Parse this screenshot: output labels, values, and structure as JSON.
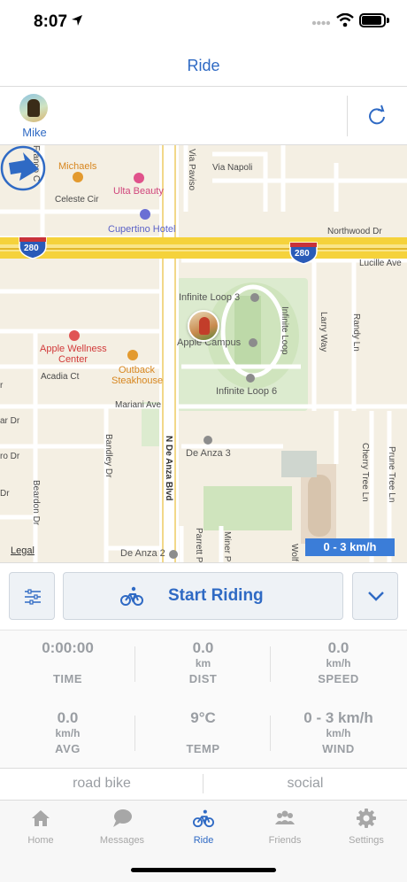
{
  "status_bar": {
    "time": "8:07"
  },
  "nav": {
    "title": "Ride"
  },
  "user": {
    "name": "Mike"
  },
  "map": {
    "pois": {
      "michaels": "Michaels",
      "ulta": "Ulta Beauty",
      "cupertino_hotel": "Cupertino Hotel",
      "infinite_loop_3": "Infinite Loop 3",
      "apple_campus": "Apple Campus",
      "infinite_loop_6": "Infinite Loop 6",
      "apple_wellness_1": "Apple Wellness",
      "apple_wellness_2": "Center",
      "outback_1": "Outback",
      "outback_2": "Steakhouse",
      "de_anza_3": "De Anza 3",
      "de_anza_2": "De Anza 2"
    },
    "streets": {
      "franco": "Franco C",
      "via_paviso": "Via Paviso",
      "via_napoli": "Via Napoli",
      "celeste": "Celeste Cir",
      "northwood": "Northwood Dr",
      "lucille": "Lucille Ave",
      "infinite_loop": "Infinite Loop",
      "larry_way": "Larry Way",
      "randy_ln": "Randy Ln",
      "acadia": "Acadia Ct",
      "mariani": "Mariani Ave",
      "n_de_anza": "N De Anza Blvd",
      "bandley": "Bandley Dr",
      "beardon": "Beardon Dr",
      "cherry_tree": "Cherry Tree Ln",
      "prune_tree": "Prune Tree Ln",
      "parrett": "Parrett P",
      "miner": "Miner P",
      "wolf": "Wolf C",
      "edge_r": "r",
      "edge_ar": "ar Dr",
      "edge_ro": "ro Dr",
      "edge_dr": "Dr"
    },
    "shields": {
      "left": "280",
      "right": "280"
    },
    "legal": "Legal",
    "wind_speed_badge": "0 - 3 km/h"
  },
  "controls": {
    "start_label": "Start Riding"
  },
  "stats": [
    {
      "value": "0:00:00",
      "unit": "",
      "label": "TIME"
    },
    {
      "value": "0.0",
      "unit": "km",
      "label": "DIST"
    },
    {
      "value": "0.0",
      "unit": "km/h",
      "label": "SPEED"
    },
    {
      "value": "0.0",
      "unit": "km/h",
      "label": "AVG"
    },
    {
      "value": "9°C",
      "unit": "",
      "label": "TEMP"
    },
    {
      "value": "0 - 3 km/h",
      "unit": "km/h",
      "label": "WIND"
    }
  ],
  "tags": {
    "bike_type": "road bike",
    "ride_type": "social"
  },
  "tabs": [
    {
      "label": "Home",
      "icon": "house-icon"
    },
    {
      "label": "Messages",
      "icon": "chat-bubble-icon"
    },
    {
      "label": "Ride",
      "icon": "bicycle-icon"
    },
    {
      "label": "Friends",
      "icon": "people-icon"
    },
    {
      "label": "Settings",
      "icon": "gear-icon"
    }
  ],
  "colors": {
    "accent": "#2f6ac4",
    "badge": "#3b7dd8",
    "muted": "#9a9ea3",
    "highway": "#f5d23b"
  }
}
